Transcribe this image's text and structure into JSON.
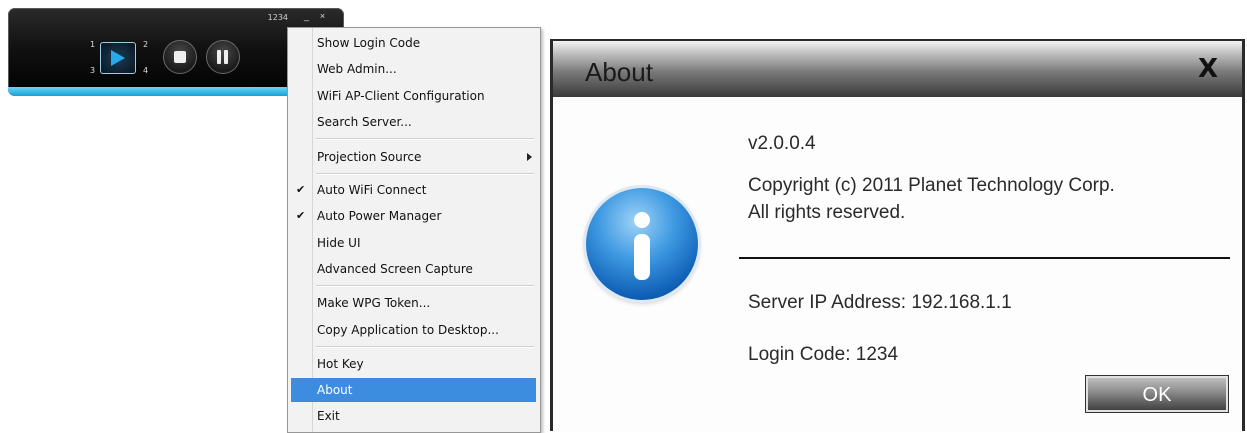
{
  "player": {
    "code": "1234",
    "minimize_glyph": "_",
    "close_glyph": "×",
    "quadrants": [
      "1",
      "2",
      "3",
      "4"
    ],
    "icons": [
      "play-icon",
      "stop-icon",
      "pause-icon",
      "minimize-icon",
      "close-icon"
    ],
    "accent_bar_color": "#13a3d8"
  },
  "menu": {
    "items": [
      {
        "label": "Show Login Code"
      },
      {
        "label": "Web Admin..."
      },
      {
        "label": "WiFi AP-Client Configuration"
      },
      {
        "label": "Search Server..."
      },
      {
        "label": "Projection Source",
        "submenu": true
      },
      {
        "label": "Auto WiFi Connect",
        "checked": true
      },
      {
        "label": "Auto Power Manager",
        "checked": true
      },
      {
        "label": "Hide UI"
      },
      {
        "label": "Advanced Screen Capture"
      },
      {
        "label": "Make WPG Token..."
      },
      {
        "label": "Copy Application to Desktop..."
      },
      {
        "label": "Hot Key"
      },
      {
        "label": "About",
        "selected": true
      },
      {
        "label": "Exit"
      }
    ],
    "check_glyph": "✔",
    "selection_color": "#3c8de0"
  },
  "about": {
    "title": "About",
    "close_glyph": "X",
    "version": "v2.0.0.4",
    "copyright": "Copyright (c)  2011 Planet Technology Corp.",
    "rights": "All rights reserved.",
    "server_ip": "Server IP Address: 192.168.1.1",
    "login_code": "Login Code: 1234",
    "ok_label": "OK",
    "icon": "info-icon"
  }
}
